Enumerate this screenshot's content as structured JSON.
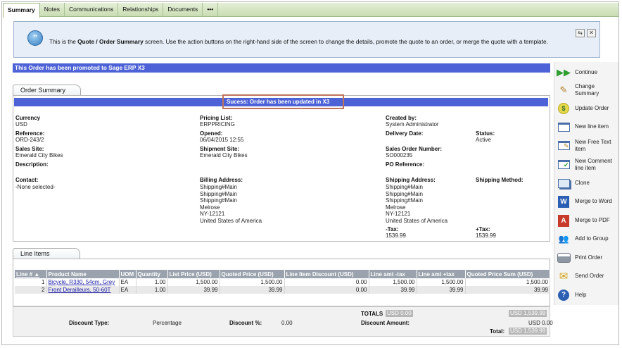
{
  "tabs": [
    "Summary",
    "Notes",
    "Communications",
    "Relationships",
    "Documents",
    "•••"
  ],
  "info": {
    "text_pre": "This is the ",
    "text_bold": "Quote / Order Summary",
    "text_post": " screen. Use the action buttons on the right-hand side of the screen to change the details, promote the quote to an order, or merge the quote with a template."
  },
  "promoted": "This Order has been promoted to Sage ERP X3",
  "order_summary_tab": "Order Summary",
  "success_msg": "Sucess: Order has been updated in X3",
  "fields": {
    "currency_label": "Currency",
    "currency": "USD",
    "reference_label": "Reference:",
    "reference": "ORD-243/2",
    "sales_site_label": "Sales Site:",
    "sales_site": "Emerald City Bikes",
    "description_label": "Description:",
    "contact_label": "Contact:",
    "contact": "-None selected-",
    "pricing_list_label": "Pricing List:",
    "pricing_list": "ERPPRICING",
    "opened_label": "Opened:",
    "opened": "06/04/2015 12:55",
    "shipment_site_label": "Shipment Site:",
    "shipment_site": "Emerald City Bikes",
    "billing_address_label": "Billing Address:",
    "billing_address": [
      "Shipping#Main",
      "Shipping#Main",
      "Shipping#Main",
      "Melrose",
      "NY-12121",
      "United States of America"
    ],
    "created_by_label": "Created by:",
    "created_by": "System Administrator",
    "delivery_date_label": "Delivery Date:",
    "sales_order_number_label": "Sales Order Number:",
    "sales_order_number": "SO000235",
    "po_reference_label": "PO Reference:",
    "shipping_address_label": "Shipping Address:",
    "shipping_address": [
      "Shipping#Main",
      "Shipping#Main",
      "Shipping#Main",
      "Melrose",
      "NY-12121",
      "United States of America"
    ],
    "minus_tax_label": "-Tax:",
    "minus_tax": "1539.99",
    "status_label": "Status:",
    "status": "Active",
    "shipping_method_label": "Shipping Method:",
    "plus_tax_label": "+Tax:",
    "plus_tax": "1539.99"
  },
  "line_items_tab": "Line Items",
  "line_items": {
    "headers": [
      "Line # ▲",
      "Product Name",
      "UOM",
      "Quantity",
      "List Price (USD)",
      "Quoted Price (USD)",
      "Line Item Discount (USD)",
      "Line amt -tax",
      "Line amt +tax",
      "Quoted Price Sum (USD)"
    ],
    "rows": [
      {
        "line": "1",
        "product": "Bicycle, R330, 54cm, Grey",
        "uom": "EA",
        "qty": "1.00",
        "list": "1,500.00",
        "quoted": "1,500.00",
        "discount": "0.00",
        "amt_minus": "1,500.00",
        "amt_plus": "1,500.00",
        "sum": "1,500.00"
      },
      {
        "line": "2",
        "product": "Front Derailleurs, 50-60T",
        "uom": "EA",
        "qty": "1.00",
        "list": "39.99",
        "quoted": "39.99",
        "discount": "0.00",
        "amt_minus": "39.99",
        "amt_plus": "39.99",
        "sum": "39.99"
      }
    ]
  },
  "totals": {
    "totals_label": "TOTALS",
    "totals_value": "USD 0.00",
    "sum_value": "USD 1,539.99",
    "discount_type_label": "Discount Type:",
    "discount_type": "Percentage",
    "discount_pct_label": "Discount %:",
    "discount_pct": "0.00",
    "discount_amount_label": "Discount Amount:",
    "discount_amount": "USD 0.00",
    "total_label": "Total:",
    "total": "USD 1,539.99"
  },
  "actions": [
    {
      "label": "Continue",
      "icon": "continue-icon"
    },
    {
      "label": "Change Summary",
      "icon": "pencil-icon"
    },
    {
      "label": "Update Order",
      "icon": "coin-icon"
    },
    {
      "label": "New line item",
      "icon": "new-line-icon"
    },
    {
      "label": "New Free Text item",
      "icon": "free-text-icon"
    },
    {
      "label": "New Comment line item",
      "icon": "comment-icon"
    },
    {
      "label": "Clone",
      "icon": "clone-icon"
    },
    {
      "label": "Merge to Word",
      "icon": "word-icon"
    },
    {
      "label": "Merge to PDF",
      "icon": "pdf-icon"
    },
    {
      "label": "Add to Group",
      "icon": "group-icon"
    },
    {
      "label": "Print Order",
      "icon": "printer-icon"
    },
    {
      "label": "Send Order",
      "icon": "envelope-icon"
    },
    {
      "label": "Help",
      "icon": "help-icon"
    }
  ]
}
